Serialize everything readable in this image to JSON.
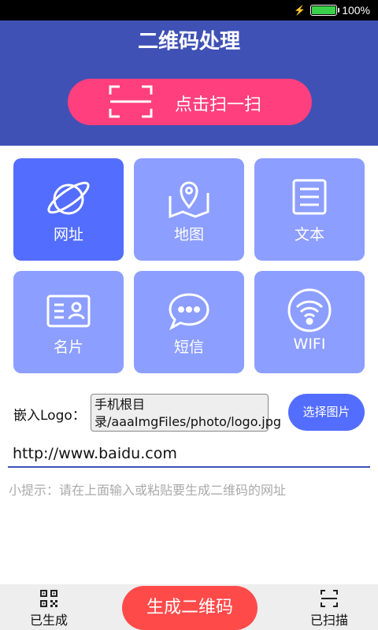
{
  "status_bar": {
    "battery": "100%"
  },
  "header": {
    "title": "二维码处理",
    "scan_button": "点击扫一扫"
  },
  "tiles": [
    {
      "label": "网址",
      "icon": "globe-icon",
      "active": true
    },
    {
      "label": "地图",
      "icon": "map-icon",
      "active": false
    },
    {
      "label": "文本",
      "icon": "document-icon",
      "active": false
    },
    {
      "label": "名片",
      "icon": "contact-card-icon",
      "active": false
    },
    {
      "label": "短信",
      "icon": "message-icon",
      "active": false
    },
    {
      "label": "WIFI",
      "icon": "wifi-icon",
      "active": false
    }
  ],
  "logo": {
    "label": "嵌入Logo：",
    "path": "手机根目录/aaaImgFiles/photo/logo.jpg",
    "choose_button": "选择图片"
  },
  "url_input": {
    "value": "http://www.baidu.com"
  },
  "hint": "小提示：请在上面输入或粘贴要生成二维码的网址",
  "bottom_nav": {
    "generated": "已生成",
    "generate_button": "生成二维码",
    "scanned": "已扫描"
  },
  "colors": {
    "header": "#3f51b5",
    "scan_button": "#ff3f7e",
    "tile": "#8c9eff",
    "tile_active": "#536dfe",
    "generate_button": "#ff4a4a"
  }
}
